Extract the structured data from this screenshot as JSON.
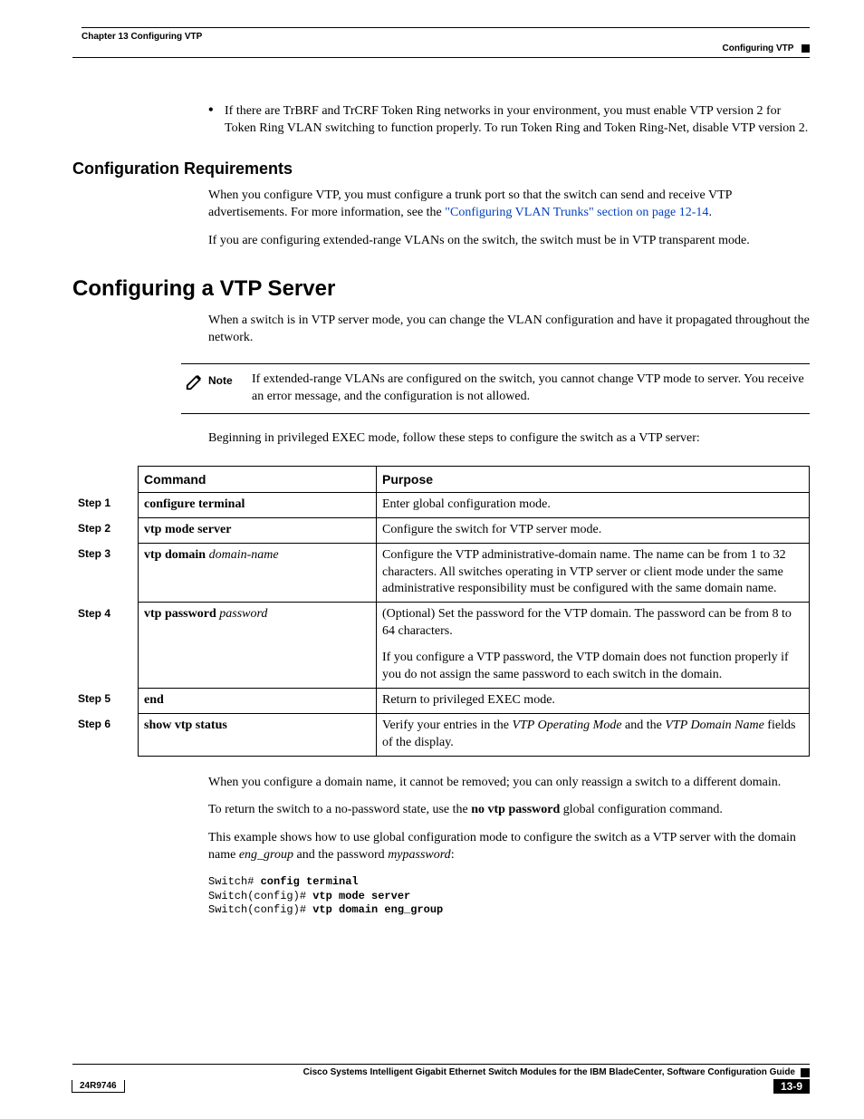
{
  "header": {
    "chapter_line": "Chapter 13    Configuring VTP",
    "section_right": "Configuring VTP"
  },
  "bullet1": "If there are TrBRF and TrCRF Token Ring networks in your environment, you must enable VTP version 2 for Token Ring VLAN switching to function properly. To run Token Ring and Token Ring-Net, disable VTP version 2.",
  "sec1_title": "Configuration Requirements",
  "sec1_p1a": "When you configure VTP, you must configure a trunk port so that the switch can send and receive VTP advertisements. For more information, see the ",
  "sec1_link": "\"Configuring VLAN Trunks\" section on page 12-14",
  "sec1_p1b": ".",
  "sec1_p2": "If you are configuring extended-range VLANs on the switch, the switch must be in VTP transparent mode.",
  "sec2_title": "Configuring a VTP Server",
  "sec2_p1": "When a switch is in VTP server mode, you can change the VLAN configuration and have it propagated throughout the network.",
  "note": {
    "label": "Note",
    "text": "If extended-range VLANs are configured on the switch, you cannot change VTP mode to server. You receive an error message, and the configuration is not allowed."
  },
  "sec2_p2": "Beginning in privileged EXEC mode, follow these steps to configure the switch as a VTP server:",
  "table": {
    "h_cmd": "Command",
    "h_purpose": "Purpose",
    "rows": [
      {
        "step": "Step 1",
        "cmd_bold": "configure terminal",
        "cmd_arg": "",
        "purpose": "Enter global configuration mode."
      },
      {
        "step": "Step 2",
        "cmd_bold": "vtp mode server",
        "cmd_arg": "",
        "purpose": "Configure the switch for VTP server mode."
      },
      {
        "step": "Step 3",
        "cmd_bold": "vtp domain",
        "cmd_arg": "domain-name",
        "purpose": "Configure the VTP administrative-domain name. The name can be from 1 to 32 characters. All switches operating in VTP server or client mode under the same administrative responsibility must be configured with the same domain name."
      },
      {
        "step": "Step 4",
        "cmd_bold": "vtp password",
        "cmd_arg": "password",
        "purpose": "(Optional) Set the password for the VTP domain. The password can be from 8 to 64 characters.",
        "purpose2": "If you configure a VTP password, the VTP domain does not function properly if you do not assign the same password to each switch in the domain."
      },
      {
        "step": "Step 5",
        "cmd_bold": "end",
        "cmd_arg": "",
        "purpose": "Return to privileged EXEC mode."
      },
      {
        "step": "Step 6",
        "cmd_bold": "show vtp status",
        "cmd_arg": "",
        "purpose_pre": "Verify your entries in the ",
        "purpose_it1": "VTP Operating Mode",
        "purpose_mid": " and the ",
        "purpose_it2": "VTP Domain Name",
        "purpose_post": " fields of the display."
      }
    ]
  },
  "after_p1": "When you configure a domain name, it cannot be removed; you can only reassign a switch to a different domain.",
  "after_p2_a": "To return the switch to a no-password state, use the ",
  "after_p2_b": "no vtp password",
  "after_p2_c": " global configuration command.",
  "after_p3_a": "This example shows how to use global configuration mode to configure the switch as a VTP server with the domain name ",
  "after_p3_i1": "eng_group",
  "after_p3_b": " and the password ",
  "after_p3_i2": "mypassword",
  "after_p3_c": ":",
  "code": {
    "l1a": "Switch# ",
    "l1b": "config terminal",
    "l2a": "Switch(config)# ",
    "l2b": "vtp mode server",
    "l3a": "Switch(config)# ",
    "l3b": "vtp domain eng_group"
  },
  "footer": {
    "title": "Cisco Systems Intelligent Gigabit Ethernet Switch Modules for the IBM BladeCenter, Software Configuration Guide",
    "doc": "24R9746",
    "page": "13-9"
  }
}
